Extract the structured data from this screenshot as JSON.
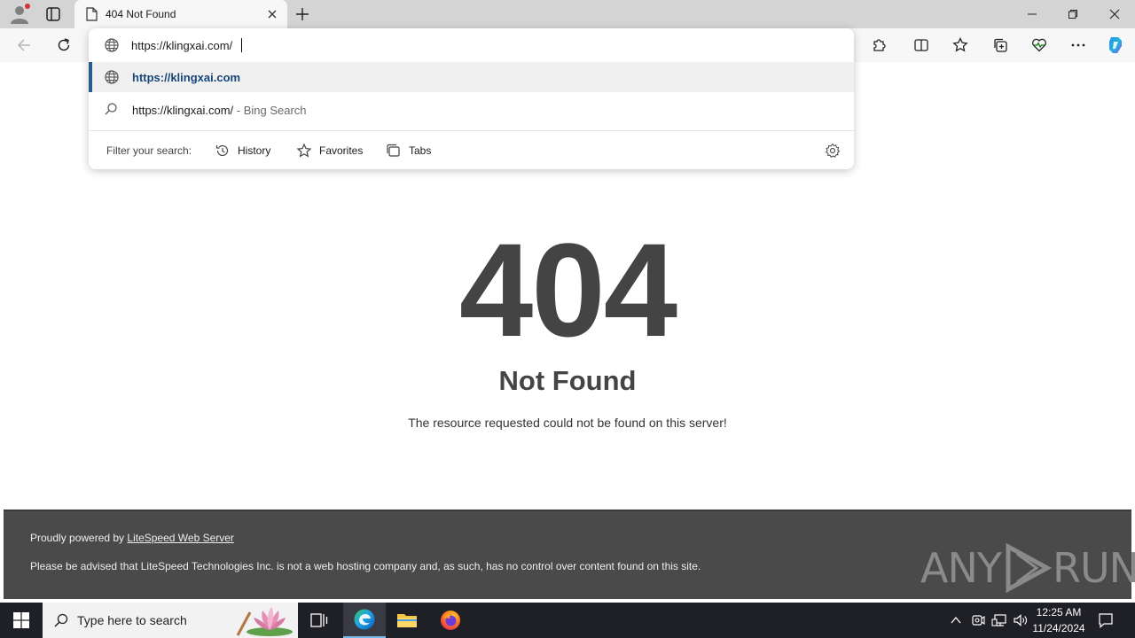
{
  "browser": {
    "tab": {
      "title": "404 Not Found"
    },
    "address_input_value": "https://klingxai.com/",
    "suggestions": [
      {
        "text": "https://klingxai.com",
        "hint": ""
      },
      {
        "text": "https://klingxai.com/",
        "hint": " - Bing Search"
      }
    ],
    "filter": {
      "label": "Filter your search:",
      "chips": [
        "History",
        "Favorites",
        "Tabs"
      ]
    }
  },
  "page": {
    "code": "404",
    "heading": "Not Found",
    "message": "The resource requested could not be found on this server!",
    "footer": {
      "powered_prefix": "Proudly powered by ",
      "powered_link": "LiteSpeed Web Server",
      "advisory": "Please be advised that LiteSpeed Technologies Inc. is not a web hosting company and, as such, has no control over content found on this site."
    },
    "watermark": {
      "left": "ANY",
      "right": "RUN"
    }
  },
  "taskbar": {
    "search_placeholder": "Type here to search",
    "time": "12:25 AM",
    "date": "11/24/2024"
  },
  "colors": {
    "accent_blue": "#17467a",
    "page_text": "#444444",
    "footer_bg": "#4a4a4a",
    "taskbar_bg": "#1f1f26",
    "profile_badge": "#d13438"
  },
  "icons": {
    "profile": "person-icon",
    "tab_actions": "tab-actions-icon",
    "tab_page": "document-icon",
    "back": "back-arrow-icon",
    "refresh": "refresh-icon",
    "extensions": "puzzle-icon",
    "split": "split-screen-icon",
    "favorites": "star-plus-icon",
    "collections": "collections-icon",
    "performance": "heart-pulse-icon",
    "more": "more-dots-icon",
    "copilot": "copilot-icon",
    "globe": "globe-icon",
    "search": "search-icon",
    "history": "history-icon",
    "settings": "gear-icon"
  }
}
